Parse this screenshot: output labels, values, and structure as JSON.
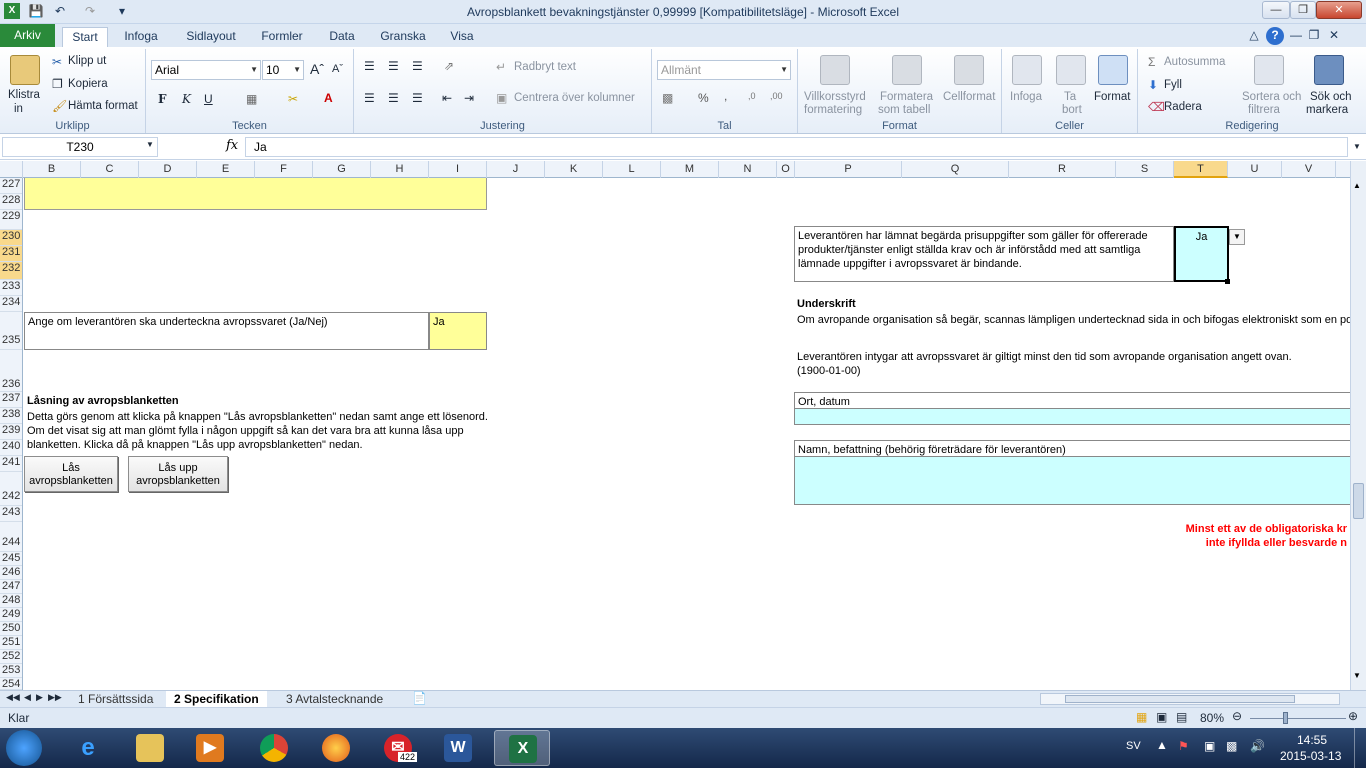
{
  "window": {
    "title": "Avropsblankett bevakningstjänster 0,99999  [Kompatibilitetsläge]  -  Microsoft Excel"
  },
  "ribbon_tabs": [
    "Arkiv",
    "Start",
    "Infoga",
    "Sidlayout",
    "Formler",
    "Data",
    "Granska",
    "Visa"
  ],
  "ribbon": {
    "clipboard": {
      "paste_line1": "Klistra",
      "paste_line2": "in",
      "cut": "Klipp ut",
      "copy": "Kopiera",
      "format_painter": "Hämta format",
      "label": "Urklipp"
    },
    "font": {
      "name": "Arial",
      "size": "10",
      "label": "Tecken",
      "bold": "F",
      "italic": "K",
      "underline": "U"
    },
    "alignment": {
      "wrap": "Radbryt text",
      "merge": "Centrera över kolumner",
      "label": "Justering"
    },
    "number": {
      "format": "Allmänt",
      "label": "Tal",
      "percent": "%",
      "comma": ","
    },
    "styles": {
      "cond_line1": "Villkorsstyrd",
      "cond_line2": "formatering",
      "table_line1": "Formatera",
      "table_line2": "som tabell",
      "cell_styles": "Cellformat",
      "label": "Format"
    },
    "cells": {
      "insert": "Infoga",
      "delete_line1": "Ta",
      "delete_line2": "bort",
      "format": "Format",
      "label": "Celler"
    },
    "editing": {
      "autosum": "Autosumma",
      "fill": "Fyll",
      "clear": "Radera",
      "sort_line1": "Sortera och",
      "sort_line2": "filtrera",
      "find_line1": "Sök och",
      "find_line2": "markera",
      "label": "Redigering"
    }
  },
  "formula_bar": {
    "name_box": "T230",
    "fx": "fx",
    "value": "Ja"
  },
  "columns": [
    "B",
    "C",
    "D",
    "E",
    "F",
    "G",
    "H",
    "I",
    "J",
    "K",
    "L",
    "M",
    "N",
    "O",
    "P",
    "Q",
    "R",
    "S",
    "T",
    "U",
    "V"
  ],
  "rows": [
    "227",
    "228",
    "229",
    "230",
    "231",
    "232",
    "233",
    "234",
    "235",
    "236",
    "237",
    "238",
    "239",
    "240",
    "241",
    "242",
    "243",
    "244",
    "245",
    "246",
    "247",
    "248",
    "249",
    "250",
    "251",
    "252",
    "253",
    "254"
  ],
  "selected": {
    "column": "T",
    "rows": [
      "230",
      "231",
      "232"
    ]
  },
  "cells": {
    "supplier_statement": "Leverantören har lämnat begärda prisuppgifter som gäller för offererade produkter/tjänster enligt ställda krav och är införstådd med att samtliga lämnade uppgifter i avropssvaret är bindande.",
    "supplier_statement_answer": "Ja",
    "sign_question": "Ange om leverantören ska underteckna avropssvaret (Ja/Nej)",
    "sign_answer": "Ja",
    "signature_heading": "Underskrift",
    "signature_text": "Om avropande organisation så begär, scannas lämpligen undertecknad sida in och bifogas elektroniskt som en pdf-",
    "validity_text": "Leverantören intygar att avropssvaret är giltigt minst den tid som avropande organisation angett ovan.",
    "validity_date": "(1900-01-00)",
    "place_date_label": "Ort, datum",
    "name_label": "Namn, befattning (behörig företrädare för leverantören)",
    "lock_heading": "Låsning av avropsblanketten",
    "lock_text_1": "Detta görs genom att klicka på knappen \"Lås avropsblanketten\" nedan samt ange ett lösenord.",
    "lock_text_2": "Om det visat sig att man glömt fylla i någon uppgift så kan det vara bra att kunna låsa upp",
    "lock_text_3": "blanketten. Klicka då på knappen \"Lås upp avropsblanketten\" nedan.",
    "lock_button_line1": "Lås",
    "lock_button_line2": "avropsblanketten",
    "unlock_button_line1": "Lås upp",
    "unlock_button_line2": "avropsblanketten",
    "warning_line1": "Minst ett av de obligatoriska kr",
    "warning_line2": "inte ifyllda eller besvarde n"
  },
  "sheet_tabs": [
    "1 Försättssida",
    "2 Specifikation",
    "3 Avtalstecknande"
  ],
  "active_sheet": "2 Specifikation",
  "status": {
    "ready": "Klar",
    "zoom": "80%"
  },
  "taskbar": {
    "lang": "SV",
    "time": "14:55",
    "date": "2015-03-13",
    "mail_badge": "422"
  },
  "colors": {
    "yellow_cell": "#ffff99",
    "cyan_cell": "#ccffff",
    "warning": "#ff0000",
    "selection_header": "#f9d98c"
  }
}
